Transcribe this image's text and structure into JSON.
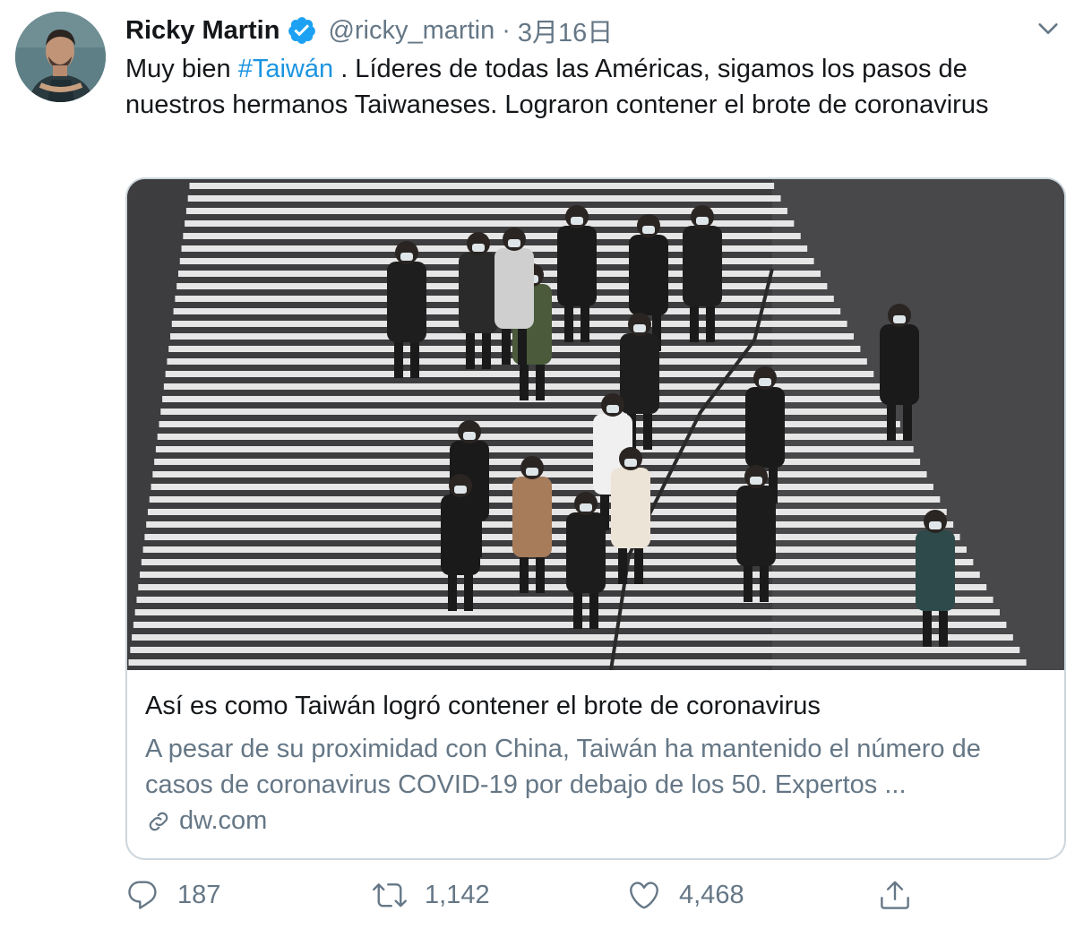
{
  "tweet": {
    "author_name": "Ricky Martin",
    "author_handle": "@ricky_martin",
    "separator": "·",
    "date": "3月16日",
    "text_before": "Muy bien ",
    "hashtag": "#Taiwán",
    "text_after": " . Líderes de todas las Américas, sigamos los pasos de nuestros hermanos Taiwaneses. Lograron contener el brote de coronavirus"
  },
  "card": {
    "title": "Así es como Taiwán logró contener el brote de coronavirus",
    "description": "A pesar de su proximidad con China, Taiwán ha mantenido el número de casos de coronavirus COVID-19 por debajo de los 50. Expertos ...",
    "domain": "dw.com"
  },
  "actions": {
    "replies": "187",
    "retweets": "1,142",
    "likes": "4,468"
  },
  "colors": {
    "link": "#1b95e0",
    "secondary_text": "#657786",
    "primary_text": "#14171a",
    "verified": "#1da1f2",
    "card_border": "#ccd6dd"
  },
  "icons": [
    "verified-badge-icon",
    "chevron-down-icon",
    "link-icon",
    "reply-icon",
    "retweet-icon",
    "like-icon",
    "share-icon"
  ]
}
